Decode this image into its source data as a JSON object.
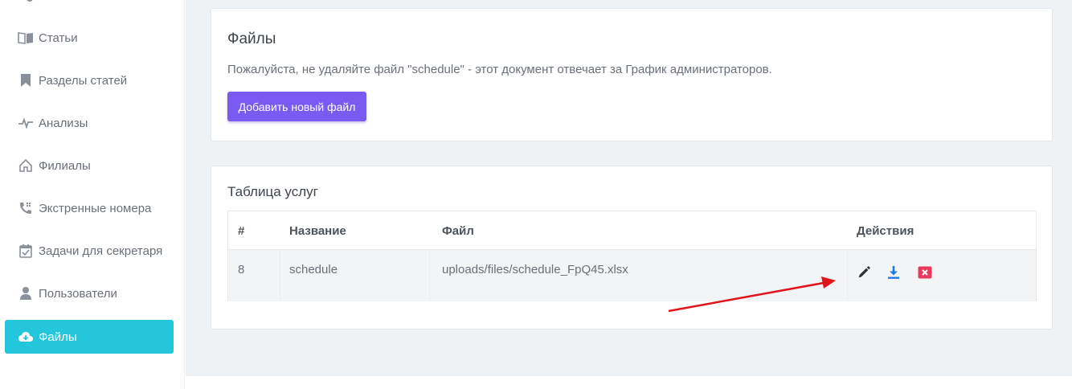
{
  "sidebar": {
    "items": [
      {
        "label": "Статьи",
        "icon": "book-icon"
      },
      {
        "label": "Разделы статей",
        "icon": "bookmark-icon"
      },
      {
        "label": "Анализы",
        "icon": "pulse-icon"
      },
      {
        "label": "Филиалы",
        "icon": "home-icon"
      },
      {
        "label": "Экстренные номера",
        "icon": "phone-icon"
      },
      {
        "label": "Задачи для секретаря",
        "icon": "calendar-check-icon"
      },
      {
        "label": "Пользователи",
        "icon": "user-icon"
      },
      {
        "label": "Файлы",
        "icon": "cloud-download-icon",
        "active": true
      }
    ],
    "active_color": "#23c6da"
  },
  "files_card": {
    "title": "Файлы",
    "description": "Пожалуйста, не удаляйте файл \"schedule\" - этот документ отвечает за График администраторов.",
    "add_button_label": "Добавить новый файл"
  },
  "table_card": {
    "title": "Таблица услуг",
    "headers": [
      "#",
      "Название",
      "Файл",
      "Действия"
    ],
    "rows": [
      {
        "id": "8",
        "name": "schedule",
        "file": "uploads/files/schedule_FpQ45.xlsx"
      }
    ],
    "actions": [
      "pencil-icon",
      "download-icon",
      "delete-icon"
    ]
  },
  "colors": {
    "primary_button": "#7a5af0",
    "download": "#1e7be6",
    "delete": "#e8395f",
    "annotation_arrow": "#e0141a"
  }
}
